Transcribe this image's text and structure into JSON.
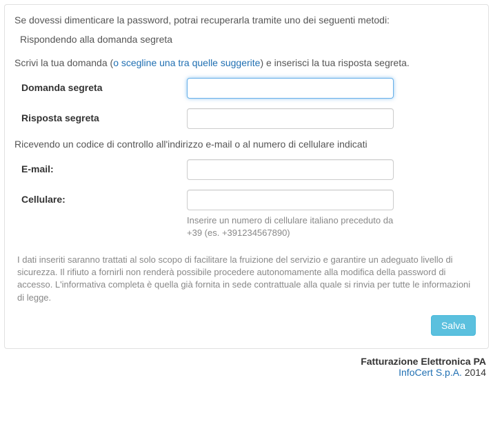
{
  "intro": "Se dovessi dimenticare la password, potrai recuperarla tramite uno dei seguenti metodi:",
  "method_answer": "Rispondendo alla domanda segreta",
  "prompt_prefix": "Scrivi la tua domanda (",
  "prompt_link": "o scegline una tra quelle suggerite",
  "prompt_suffix": ") e inserisci la tua risposta segreta.",
  "fields": {
    "question": {
      "label": "Domanda segreta",
      "value": ""
    },
    "answer": {
      "label": "Risposta segreta",
      "value": ""
    },
    "email": {
      "label": "E-mail:",
      "value": ""
    },
    "phone": {
      "label": "Cellulare:",
      "value": "",
      "help": "Inserire un numero di cellulare italiano preceduto da +39 (es. +391234567890)"
    }
  },
  "method_code": "Ricevendo un codice di controllo all'indirizzo e-mail o al numero di cellulare indicati",
  "legal": "I dati inseriti saranno trattati al solo scopo di facilitare la fruizione del servizio e garantire un adeguato livello di sicurezza. Il rifiuto a fornirli non renderà possibile procedere autonomamente alla modifica della password di accesso. L'informativa completa è quella già fornita in sede contrattuale alla quale si rinvia per tutte le informazioni di legge.",
  "save_label": "Salva",
  "footer": {
    "title": "Fatturazione Elettronica PA",
    "company": "InfoCert S.p.A.",
    "year": "2014"
  }
}
